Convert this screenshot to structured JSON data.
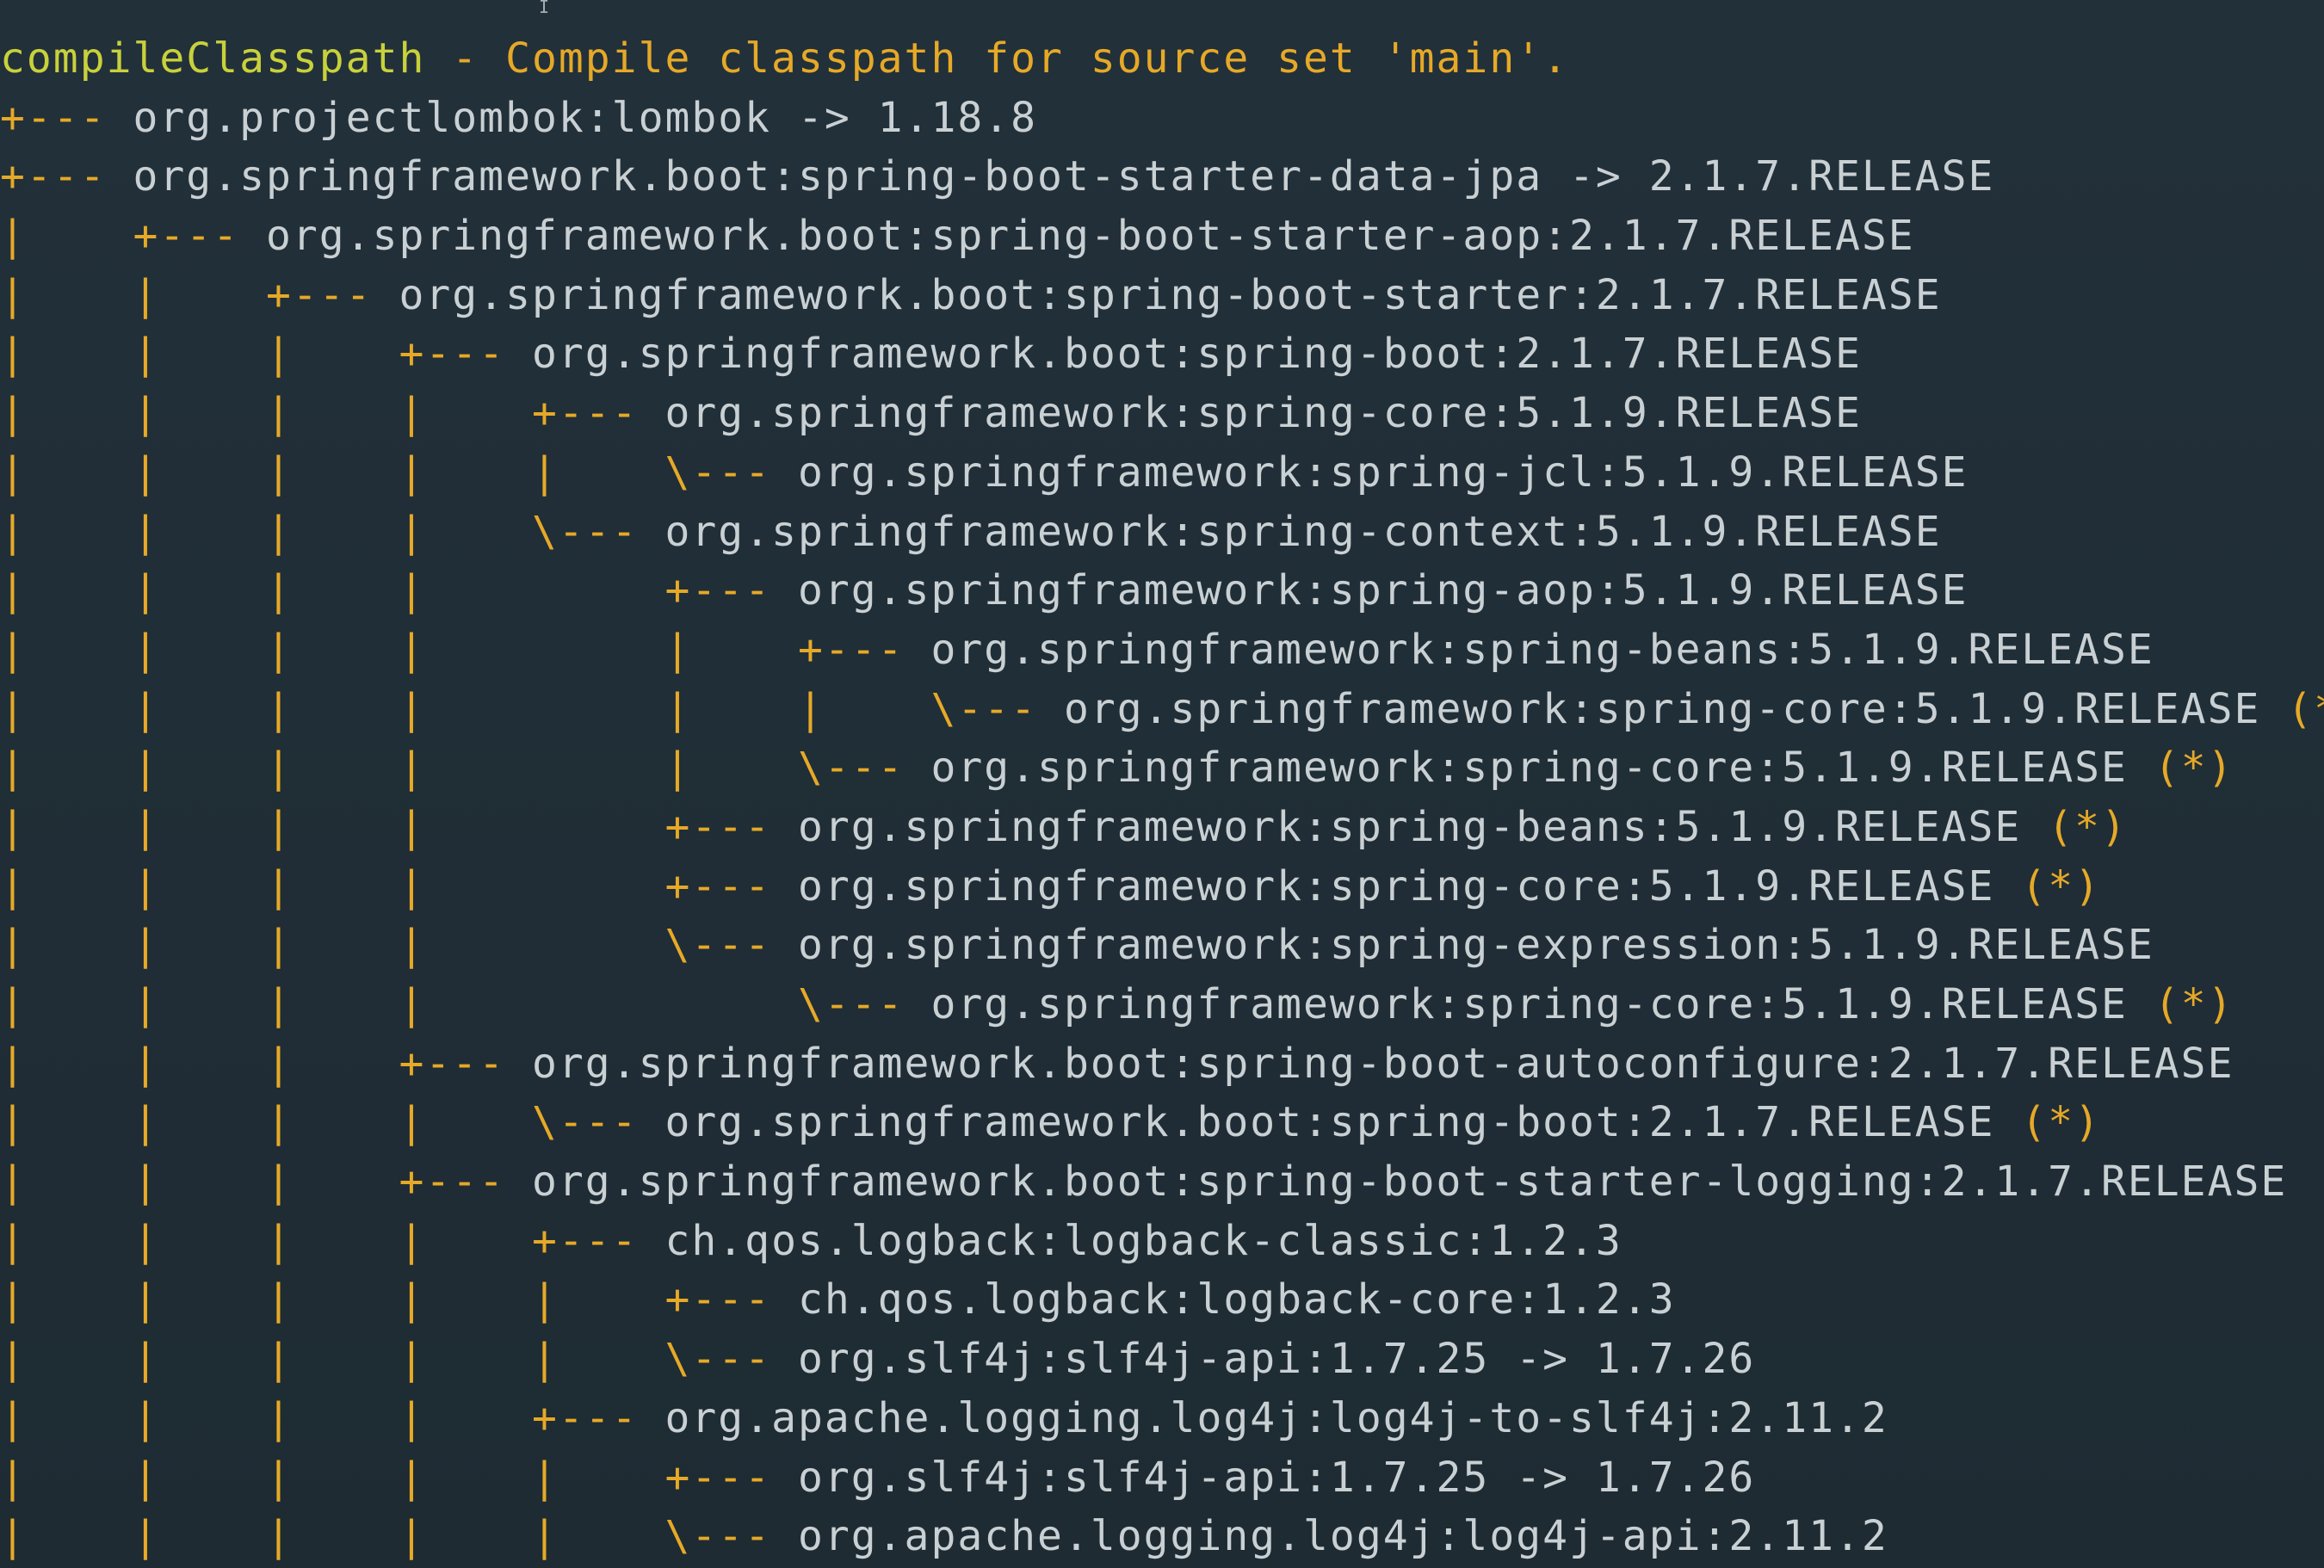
{
  "terminal": {
    "cursor_glyph": "I",
    "header": {
      "name": "compileClasspath",
      "description": " - Compile classpath for source set 'main'."
    },
    "lines": [
      {
        "prefix": "+--- ",
        "text": "org.projectlombok:lombok -> 1.18.8",
        "mark": ""
      },
      {
        "prefix": "+--- ",
        "text": "org.springframework.boot:spring-boot-starter-data-jpa -> 2.1.7.RELEASE",
        "mark": ""
      },
      {
        "prefix": "|    +--- ",
        "text": "org.springframework.boot:spring-boot-starter-aop:2.1.7.RELEASE",
        "mark": ""
      },
      {
        "prefix": "|    |    +--- ",
        "text": "org.springframework.boot:spring-boot-starter:2.1.7.RELEASE",
        "mark": ""
      },
      {
        "prefix": "|    |    |    +--- ",
        "text": "org.springframework.boot:spring-boot:2.1.7.RELEASE",
        "mark": ""
      },
      {
        "prefix": "|    |    |    |    +--- ",
        "text": "org.springframework:spring-core:5.1.9.RELEASE",
        "mark": ""
      },
      {
        "prefix": "|    |    |    |    |    \\--- ",
        "text": "org.springframework:spring-jcl:5.1.9.RELEASE",
        "mark": ""
      },
      {
        "prefix": "|    |    |    |    \\--- ",
        "text": "org.springframework:spring-context:5.1.9.RELEASE",
        "mark": ""
      },
      {
        "prefix": "|    |    |    |         +--- ",
        "text": "org.springframework:spring-aop:5.1.9.RELEASE",
        "mark": ""
      },
      {
        "prefix": "|    |    |    |         |    +--- ",
        "text": "org.springframework:spring-beans:5.1.9.RELEASE",
        "mark": ""
      },
      {
        "prefix": "|    |    |    |         |    |    \\--- ",
        "text": "org.springframework:spring-core:5.1.9.RELEASE",
        "mark": " (*)"
      },
      {
        "prefix": "|    |    |    |         |    \\--- ",
        "text": "org.springframework:spring-core:5.1.9.RELEASE",
        "mark": " (*)"
      },
      {
        "prefix": "|    |    |    |         +--- ",
        "text": "org.springframework:spring-beans:5.1.9.RELEASE",
        "mark": " (*)"
      },
      {
        "prefix": "|    |    |    |         +--- ",
        "text": "org.springframework:spring-core:5.1.9.RELEASE",
        "mark": " (*)"
      },
      {
        "prefix": "|    |    |    |         \\--- ",
        "text": "org.springframework:spring-expression:5.1.9.RELEASE",
        "mark": ""
      },
      {
        "prefix": "|    |    |    |              \\--- ",
        "text": "org.springframework:spring-core:5.1.9.RELEASE",
        "mark": " (*)"
      },
      {
        "prefix": "|    |    |    +--- ",
        "text": "org.springframework.boot:spring-boot-autoconfigure:2.1.7.RELEASE",
        "mark": ""
      },
      {
        "prefix": "|    |    |    |    \\--- ",
        "text": "org.springframework.boot:spring-boot:2.1.7.RELEASE",
        "mark": " (*)"
      },
      {
        "prefix": "|    |    |    +--- ",
        "text": "org.springframework.boot:spring-boot-starter-logging:2.1.7.RELEASE",
        "mark": ""
      },
      {
        "prefix": "|    |    |    |    +--- ",
        "text": "ch.qos.logback:logback-classic:1.2.3",
        "mark": ""
      },
      {
        "prefix": "|    |    |    |    |    +--- ",
        "text": "ch.qos.logback:logback-core:1.2.3",
        "mark": ""
      },
      {
        "prefix": "|    |    |    |    |    \\--- ",
        "text": "org.slf4j:slf4j-api:1.7.25 -> 1.7.26",
        "mark": ""
      },
      {
        "prefix": "|    |    |    |    +--- ",
        "text": "org.apache.logging.log4j:log4j-to-slf4j:2.11.2",
        "mark": ""
      },
      {
        "prefix": "|    |    |    |    |    +--- ",
        "text": "org.slf4j:slf4j-api:1.7.25 -> 1.7.26",
        "mark": ""
      },
      {
        "prefix": "|    |    |    |    |    \\--- ",
        "text": "org.apache.logging.log4j:log4j-api:2.11.2",
        "mark": ""
      }
    ]
  },
  "colors": {
    "background": "#1f2d35",
    "tree": "#e6a927",
    "dependency_text": "#c9d0d3",
    "header_name": "#c8d13b"
  }
}
